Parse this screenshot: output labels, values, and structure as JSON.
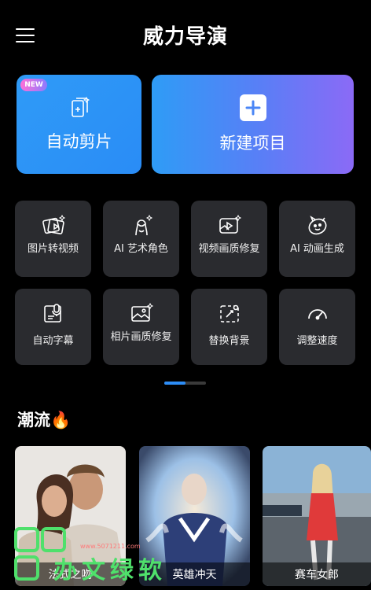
{
  "header": {
    "title": "威力导演"
  },
  "big_cards": {
    "auto_cut": {
      "label": "自动剪片",
      "badge": "NEW"
    },
    "new_project": {
      "label": "新建项目"
    }
  },
  "tools": [
    {
      "label": "图片转视频",
      "icon": "photo-to-video-icon"
    },
    {
      "label": "AI 艺术角色",
      "icon": "ai-art-character-icon"
    },
    {
      "label": "视频画质修复",
      "icon": "video-enhance-icon"
    },
    {
      "label": "AI 动画生成",
      "icon": "ai-animation-icon"
    },
    {
      "label": "自动字幕",
      "icon": "auto-caption-icon"
    },
    {
      "label": "相片画质修复",
      "icon": "photo-enhance-icon"
    },
    {
      "label": "替换背景",
      "icon": "replace-background-icon"
    },
    {
      "label": "调整速度",
      "icon": "speed-icon"
    }
  ],
  "pager": {
    "pages": 2,
    "current": 1
  },
  "trend": {
    "title": "潮流🔥",
    "items": [
      {
        "label": "法式之吻"
      },
      {
        "label": "英雄冲天"
      },
      {
        "label": "赛车女郎"
      }
    ]
  },
  "watermark": {
    "text": "办文绿软",
    "url": "www.5071211.com"
  },
  "colors": {
    "accent_blue": "#2d8df6",
    "tile_bg": "#2a2b2f",
    "gradient_purple": "#8b6af6"
  }
}
